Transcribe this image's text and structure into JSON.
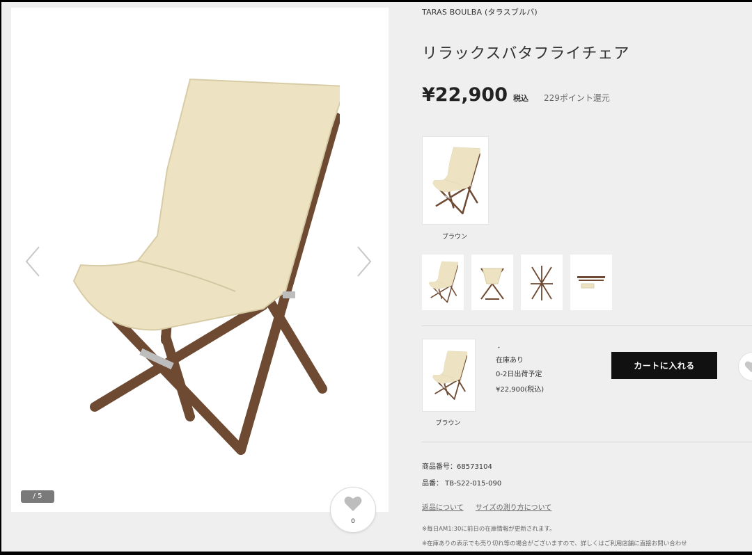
{
  "gallery": {
    "counter": "/ 5",
    "favorite_count": "0"
  },
  "product": {
    "brand": "TARAS BOULBA (タラスブルバ)",
    "title": "リラックスバタフライチェア",
    "price": "¥22,900",
    "tax_label": "税込",
    "points": "229ポイント還元"
  },
  "colors": [
    {
      "label": "ブラウン"
    }
  ],
  "stock": {
    "dot": "・",
    "status": "在庫あり",
    "shipping": "0-2日出荷予定",
    "price": "¥22,900(税込)",
    "color_label": "ブラウン",
    "cart_button": "カートに入れる"
  },
  "specs": {
    "product_number": "商品番号：68573104",
    "model_number": "品番： TB-S22-015-090"
  },
  "links": {
    "returns": "返品について",
    "size": "サイズの測り方について"
  },
  "notes": {
    "note1": "※毎日AM1:30に前日の在庫情報が更新されます。",
    "note2": "※在庫ありの表示でも売り切れ等の場合がございますので、詳しくはご利用店舗に直接お問い合わせ"
  },
  "icons": {
    "prev": "chevron-left-icon",
    "next": "chevron-right-icon",
    "favorite": "heart-icon"
  },
  "colors_theme": {
    "button_bg": "#111111",
    "page_bg": "#efefef",
    "canvas": "#ede3c3",
    "wood": "#6e4a33"
  }
}
